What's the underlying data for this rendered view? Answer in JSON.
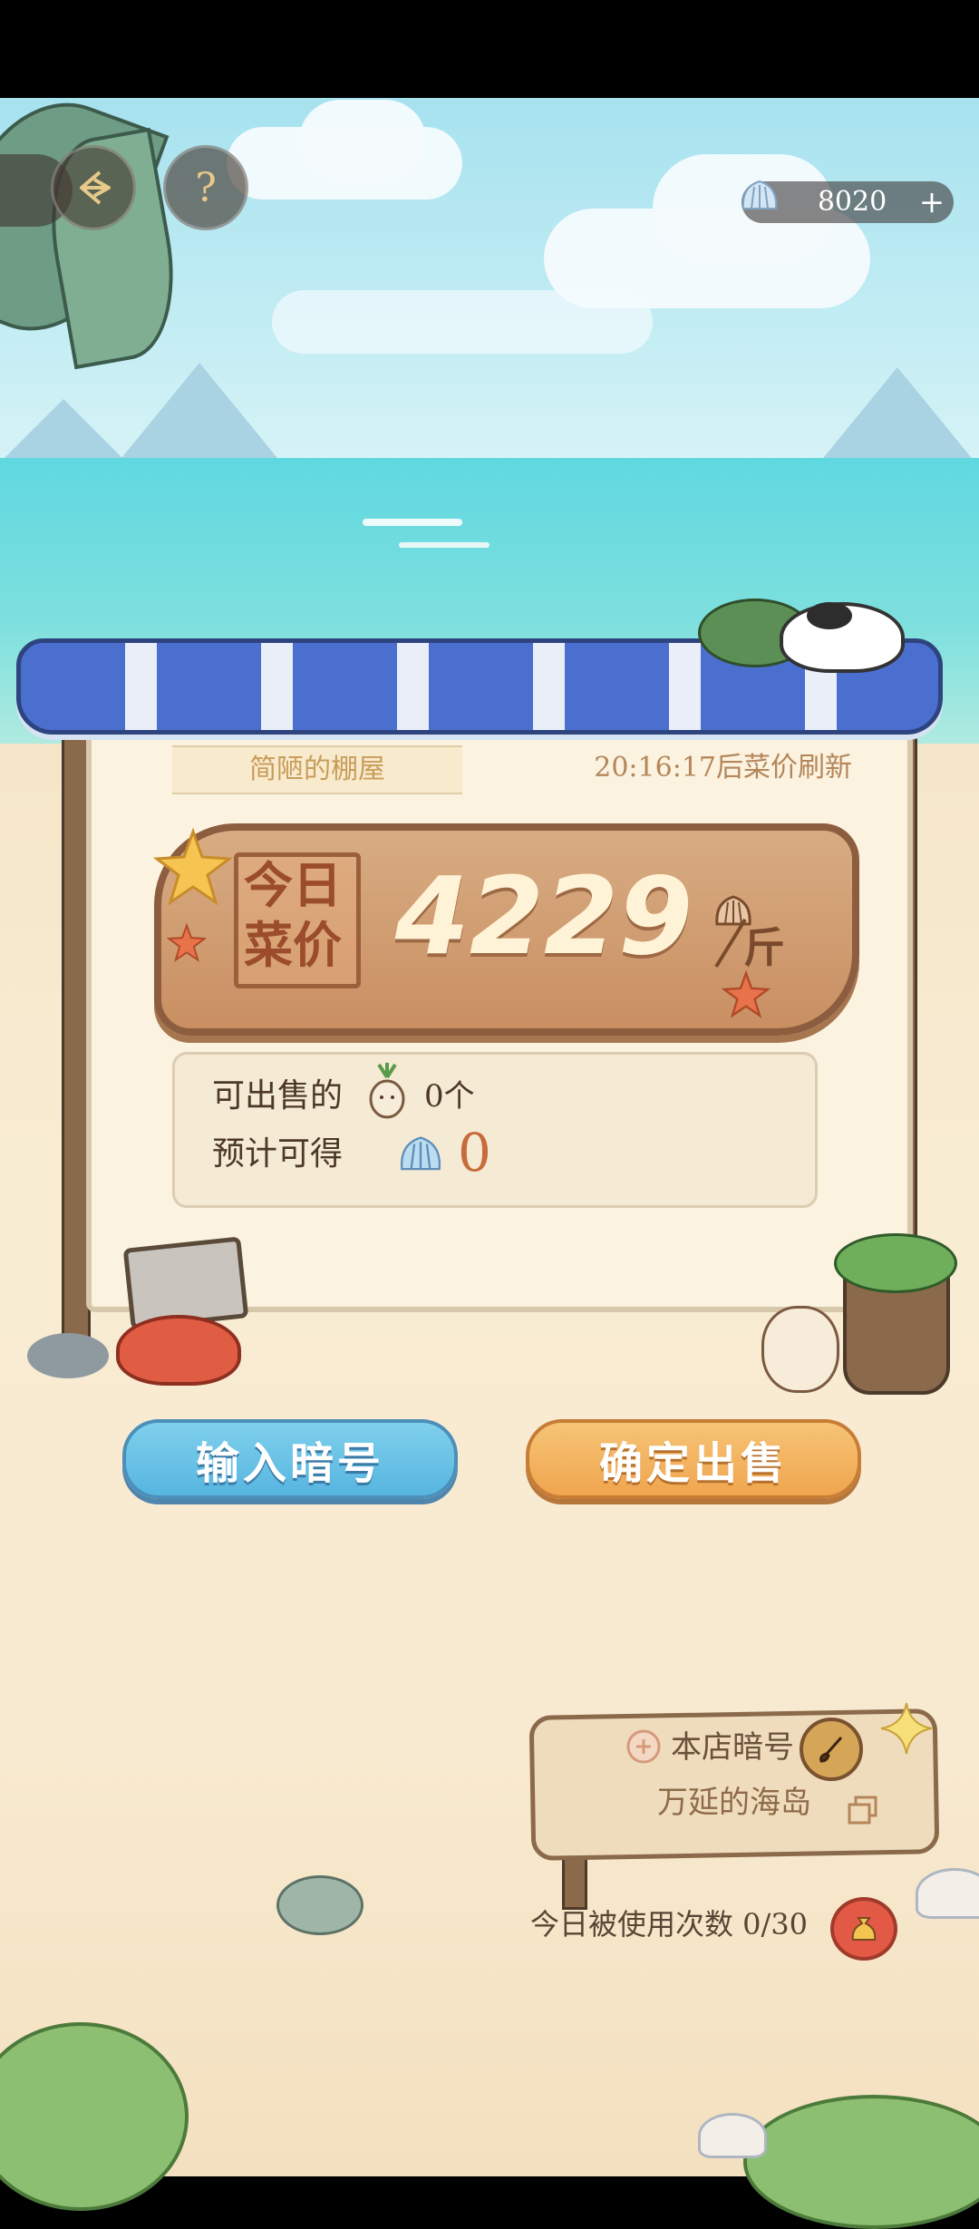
{
  "hud": {
    "back_icon": "back-arrow-icon",
    "help_icon": "help-icon",
    "help_glyph": "?",
    "currency_icon": "shell-icon",
    "currency_value": "8020",
    "plus_glyph": "+"
  },
  "shop": {
    "name": "简陋的棚屋",
    "refresh_text": "20:16:17后菜价刷新",
    "price_title_line1": "今日",
    "price_title_line2": "菜价",
    "price_value": "4229",
    "price_unit": "斤",
    "sellable_label": "可出售的",
    "sellable_count": "0个",
    "expected_label": "预计可得",
    "expected_value": "0"
  },
  "buttons": {
    "enter_code": "输入暗号",
    "confirm_sell": "确定出售"
  },
  "code_sign": {
    "label": "本店暗号",
    "value": "万延的海岛",
    "usage": "今日被使用次数 0/30"
  },
  "colors": {
    "sky": "#a7e2ef",
    "sea": "#5fd8e0",
    "sand": "#f8ecd3",
    "awning_blue": "#4b6fcf",
    "button_blue": "#57b5e0",
    "button_orange": "#f0a54e"
  }
}
